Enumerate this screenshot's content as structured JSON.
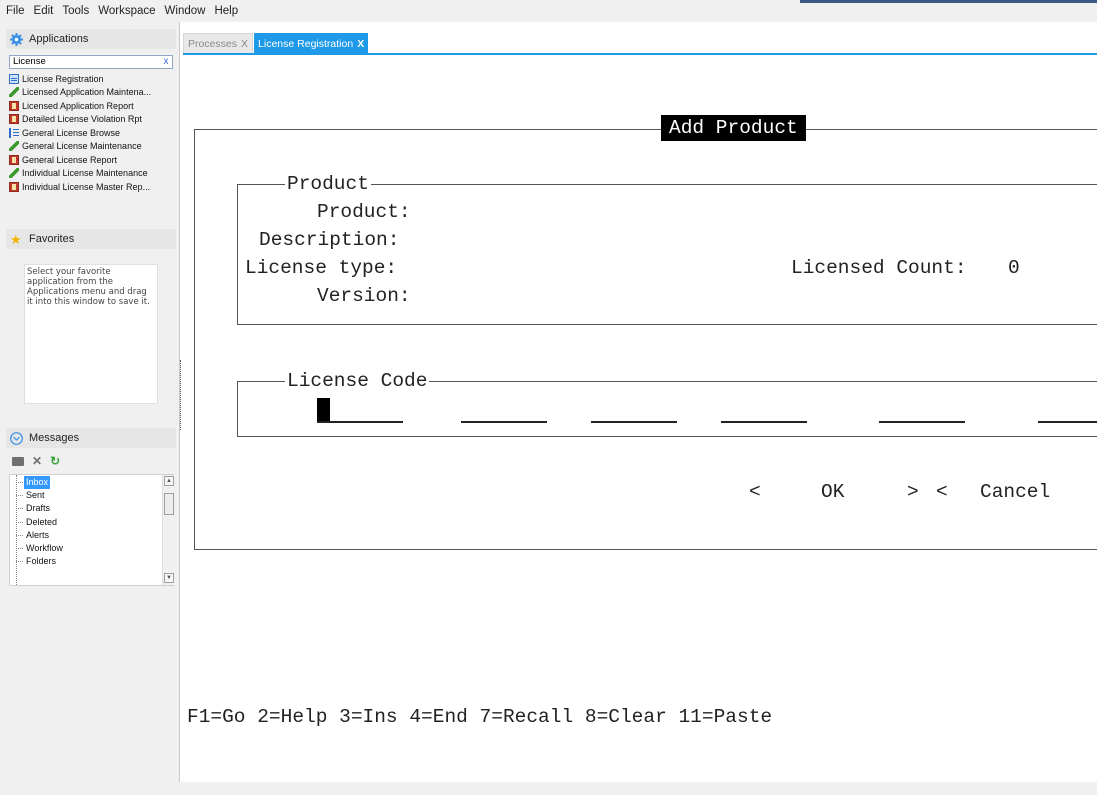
{
  "menu": [
    "File",
    "Edit",
    "Tools",
    "Workspace",
    "Window",
    "Help"
  ],
  "applications": {
    "header": "Applications",
    "search_value": "License",
    "clear_label": "x",
    "items": [
      {
        "label": "License Registration",
        "icon": "registration-icon"
      },
      {
        "label": "Licensed Application Maintena...",
        "icon": "pencil-icon"
      },
      {
        "label": "Licensed Application Report",
        "icon": "report-icon"
      },
      {
        "label": "Detailed License Violation Rpt",
        "icon": "report-icon"
      },
      {
        "label": "General License Browse",
        "icon": "list-icon"
      },
      {
        "label": "General License Maintenance",
        "icon": "pencil-icon"
      },
      {
        "label": "General License Report",
        "icon": "report-icon"
      },
      {
        "label": "Individual License Maintenance",
        "icon": "pencil-icon"
      },
      {
        "label": "Individual License Master Rep...",
        "icon": "report-icon"
      }
    ]
  },
  "favorites": {
    "header": "Favorites",
    "hint": "Select your favorite application from the Applications menu and drag it into this window to save it."
  },
  "messages": {
    "header": "Messages",
    "folders": [
      "Inbox",
      "Sent",
      "Drafts",
      "Deleted",
      "Alerts",
      "Workflow",
      "Folders"
    ],
    "selected": "Inbox"
  },
  "tabs": [
    {
      "label": "Processes",
      "close": "X",
      "active": false
    },
    {
      "label": "License Registration",
      "close": "X",
      "active": true
    }
  ],
  "dialog": {
    "title": "Add Product",
    "product_group": "Product",
    "fields": {
      "product": "Product:",
      "description": "Description:",
      "license_type": "License type:",
      "version": "Version:",
      "licensed_count_label": "Licensed Count:",
      "licensed_count_value": "0"
    },
    "license_code_group": "License Code",
    "buttons": {
      "ok_left": "<",
      "ok": "OK",
      "ok_right": ">",
      "cancel_left": "<",
      "cancel": "Cancel"
    }
  },
  "function_keys": "F1=Go 2=Help 3=Ins 4=End 7=Recall 8=Clear 11=Paste",
  "colors": {
    "tab_active": "#1e9ae8",
    "selection": "#3399ff",
    "dialog_title_bg": "#000000"
  }
}
